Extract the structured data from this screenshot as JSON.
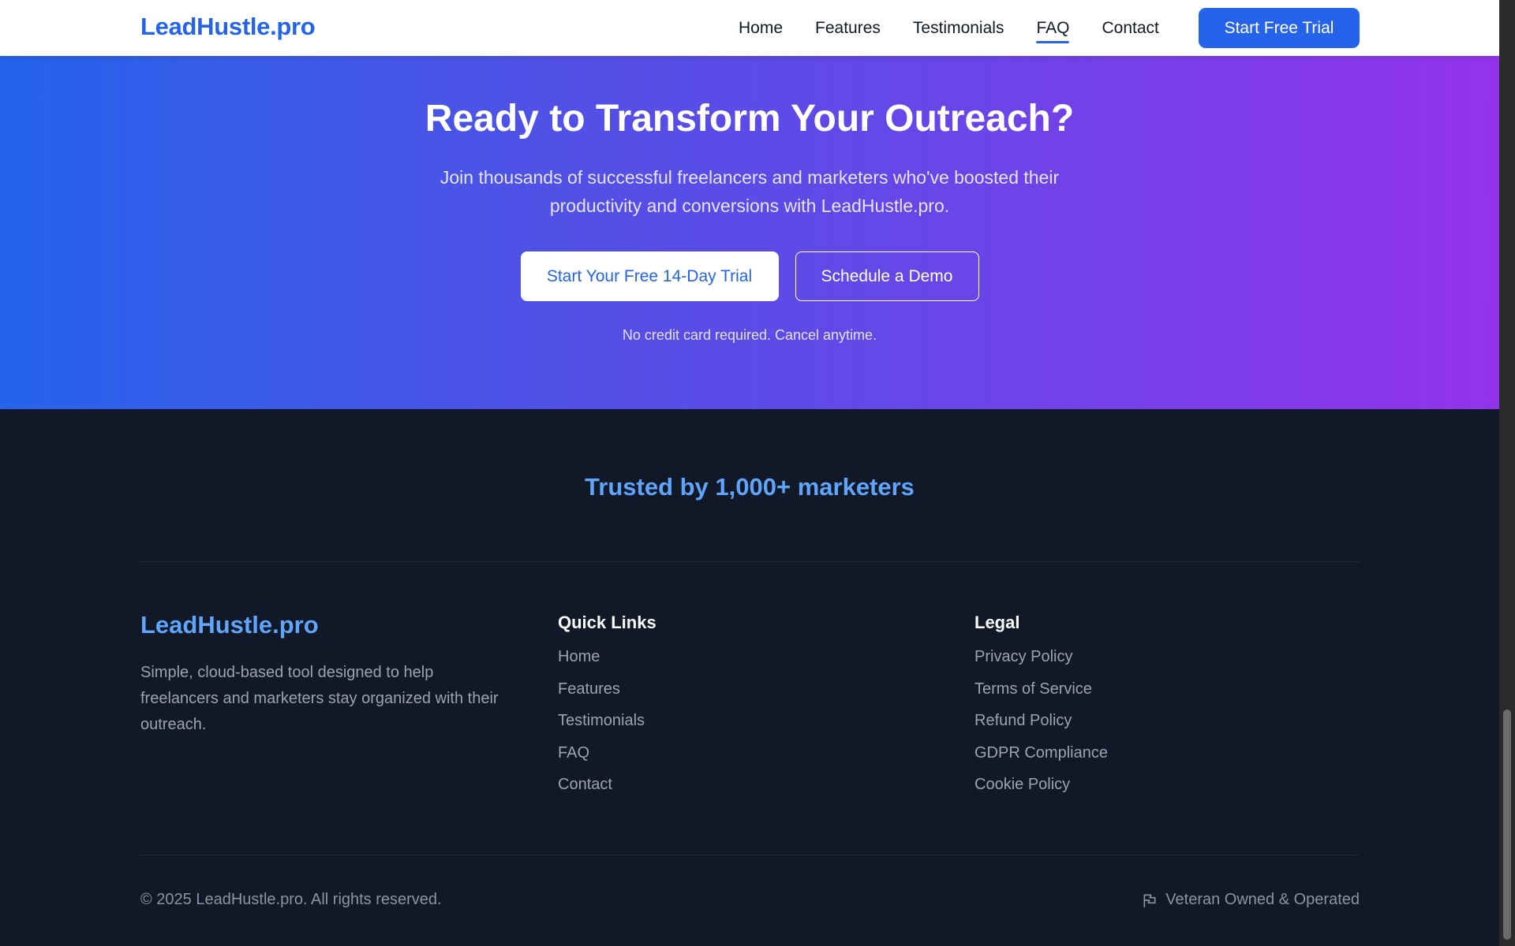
{
  "header": {
    "logo": "LeadHustle.pro",
    "nav": [
      {
        "label": "Home",
        "active": false
      },
      {
        "label": "Features",
        "active": false
      },
      {
        "label": "Testimonials",
        "active": false
      },
      {
        "label": "FAQ",
        "active": true
      },
      {
        "label": "Contact",
        "active": false
      }
    ],
    "cta_label": "Start Free Trial"
  },
  "hero": {
    "title": "Ready to Transform Your Outreach?",
    "subtitle": "Join thousands of successful freelancers and marketers who've boosted their productivity and conversions with LeadHustle.pro.",
    "primary_button": "Start Your Free 14-Day Trial",
    "secondary_button": "Schedule a Demo",
    "note": "No credit card required. Cancel anytime."
  },
  "footer": {
    "trusted": "Trusted by 1,000+ marketers",
    "brand": "LeadHustle.pro",
    "description": "Simple, cloud-based tool designed to help freelancers and marketers stay organized with their outreach.",
    "quick_links": {
      "heading": "Quick Links",
      "items": [
        "Home",
        "Features",
        "Testimonials",
        "FAQ",
        "Contact"
      ]
    },
    "legal": {
      "heading": "Legal",
      "items": [
        "Privacy Policy",
        "Terms of Service",
        "Refund Policy",
        "GDPR Compliance",
        "Cookie Policy"
      ]
    },
    "copyright": "© 2025 LeadHustle.pro. All rights reserved.",
    "veteran": "Veteran Owned & Operated",
    "veteran_icon": "flag-icon"
  },
  "colors": {
    "brand_blue": "#2563eb",
    "accent_light_blue": "#60a5fa",
    "gradient_end": "#9333ea",
    "footer_bg": "#111827"
  }
}
